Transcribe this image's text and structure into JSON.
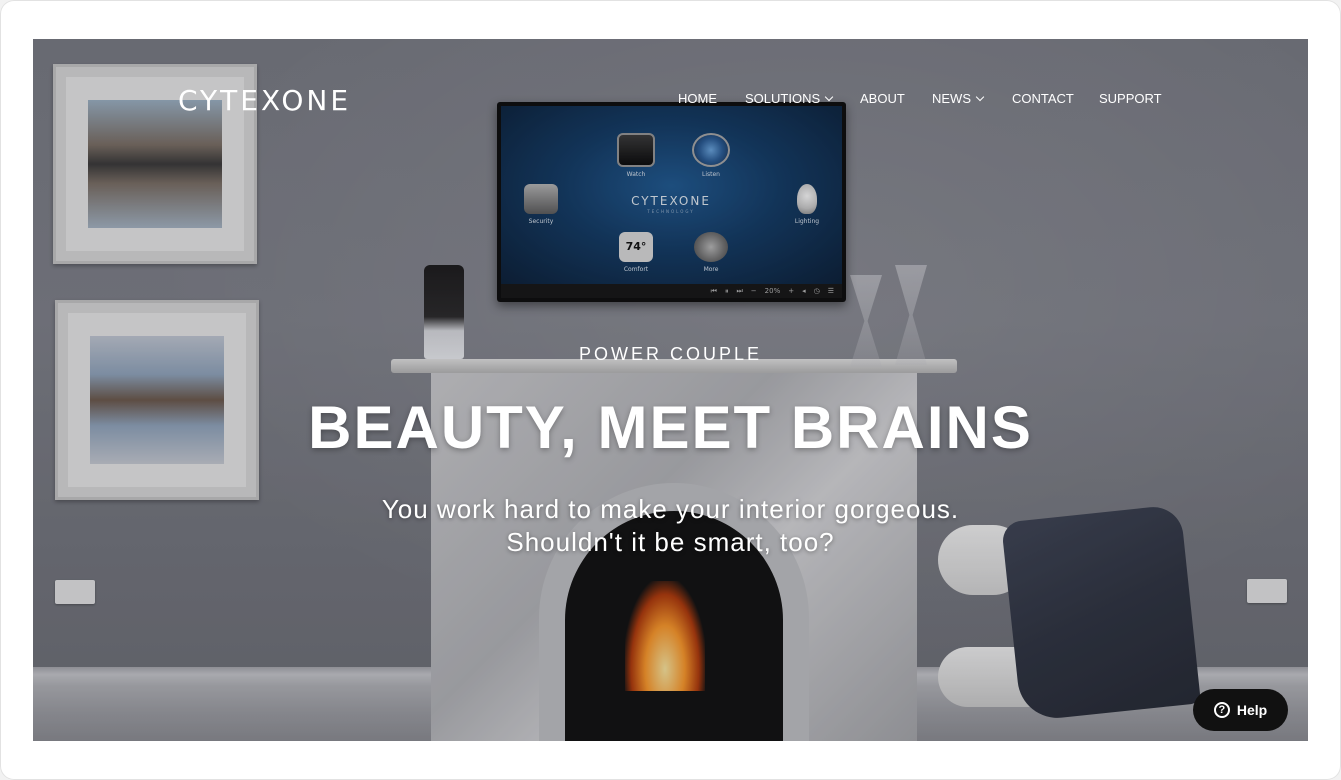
{
  "brand": {
    "logo_text": "CYTEXONE"
  },
  "nav": {
    "items": [
      {
        "label": "HOME",
        "has_dropdown": false
      },
      {
        "label": "SOLUTIONS",
        "has_dropdown": true
      },
      {
        "label": "ABOUT",
        "has_dropdown": false
      },
      {
        "label": "NEWS",
        "has_dropdown": true
      },
      {
        "label": "CONTACT",
        "has_dropdown": false
      },
      {
        "label": "SUPPORT",
        "has_dropdown": false
      }
    ]
  },
  "hero": {
    "eyebrow": "POWER COUPLE",
    "headline": "BEAUTY, MEET BRAINS",
    "subtext_line1": "You work hard to make your interior gorgeous.",
    "subtext_line2": "Shouldn't it be smart, too?"
  },
  "tv": {
    "logo": "CYTEXONE",
    "logo_sub": "TECHNOLOGY",
    "tiles": {
      "watch": "Watch",
      "listen": "Listen",
      "security": "Security",
      "lighting": "Lighting",
      "comfort": "Comfort",
      "more": "More",
      "comfort_temp": "74°"
    },
    "volume_label": "20%"
  },
  "help": {
    "label": "Help",
    "icon": "question-circle-icon"
  }
}
